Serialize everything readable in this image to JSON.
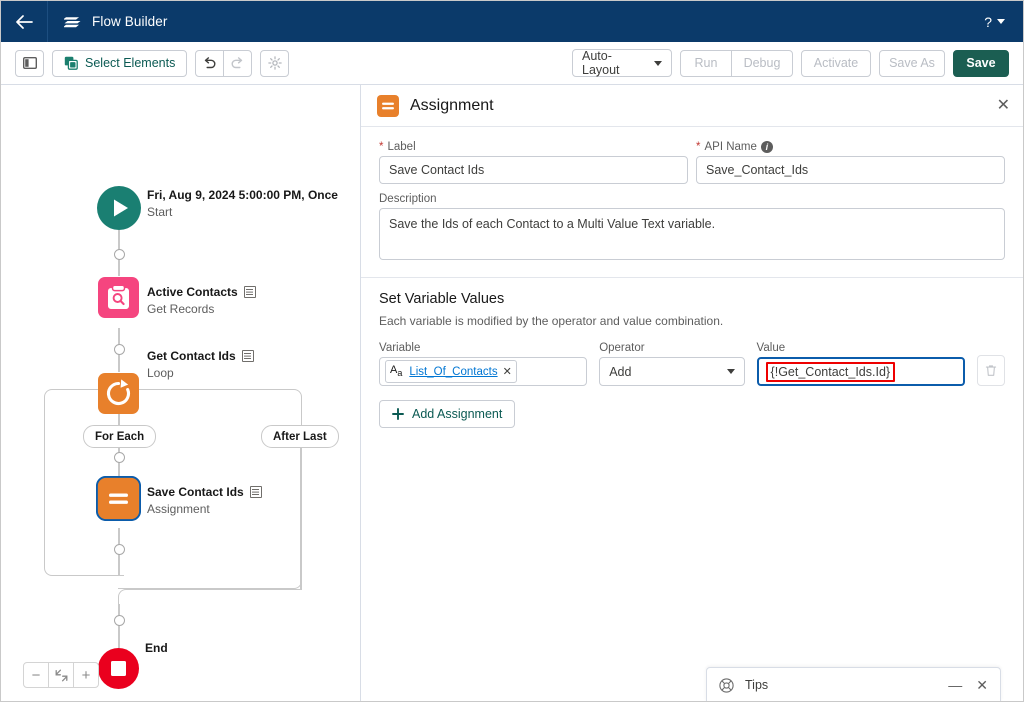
{
  "topbar": {
    "back_icon": "arrow-left-icon",
    "app_icon": "flow-builder-logo-icon",
    "title": "Flow Builder",
    "help_label": "?"
  },
  "toolbar": {
    "toggle_panel_icon": "toggle-left-panel-icon",
    "select_elements_label": "Select Elements",
    "select_elements_icon": "copy-elements-icon",
    "undo_icon": "undo-icon",
    "redo_icon": "redo-icon",
    "settings_icon": "gear-icon",
    "layout_mode": "Auto-Layout",
    "run_label": "Run",
    "debug_label": "Debug",
    "activate_label": "Activate",
    "save_as_label": "Save As",
    "save_label": "Save",
    "accent_color": "#1b5e52"
  },
  "canvas": {
    "start": {
      "icon": "play-icon",
      "title": "Fri, Aug 9, 2024 5:00:00 PM, Once",
      "subtitle": "Start",
      "color": "#1a7f72"
    },
    "nodes": [
      {
        "icon": "get-records-icon",
        "title": "Active Contacts",
        "subtitle": "Get Records",
        "color": "#f5457f"
      },
      {
        "icon": "loop-icon",
        "title": "Get Contact Ids",
        "subtitle": "Loop",
        "color": "#e8802b"
      },
      {
        "icon": "assignment-icon",
        "title": "Save Contact Ids",
        "subtitle": "Assignment",
        "color": "#e8802b"
      }
    ],
    "branch_labels": {
      "for_each": "For Each",
      "after_last": "After Last"
    },
    "end": {
      "icon": "stop-icon",
      "title": "End",
      "color": "#ea001e"
    },
    "zoom_controls": {
      "zoom_out": "−",
      "fit": "fit-to-view-icon",
      "zoom_in": "+"
    }
  },
  "panel": {
    "icon": "assignment-icon",
    "title": "Assignment",
    "close_icon": "close-icon",
    "label_field": {
      "label": "Label",
      "required": true,
      "value": "Save Contact Ids"
    },
    "api_name_field": {
      "label": "API Name",
      "required": true,
      "value": "Save_Contact_Ids",
      "info_icon": "info-icon"
    },
    "description_field": {
      "label": "Description",
      "value": "Save the Ids of each Contact to a Multi Value Text variable."
    },
    "set_variable_values": {
      "title": "Set Variable Values",
      "subtitle": "Each variable is modified by the operator and value combination.",
      "columns": {
        "variable": "Variable",
        "operator": "Operator",
        "value": "Value"
      },
      "rows": [
        {
          "variable_pill": "List_Of_Contacts",
          "variable_type_icon": "text-type-icon",
          "remove_icon": "close-icon",
          "operator": "Add",
          "value": "{!Get_Contact_Ids.Id}",
          "value_focused": true,
          "value_highlight_color": "#ee0000",
          "delete_icon": "trash-icon"
        }
      ],
      "add_assignment_label": "Add Assignment",
      "add_icon": "plus-icon"
    }
  },
  "tips": {
    "icon": "tips-globe-icon",
    "label": "Tips",
    "minimize_icon": "minimize-icon",
    "close_icon": "close-icon"
  }
}
